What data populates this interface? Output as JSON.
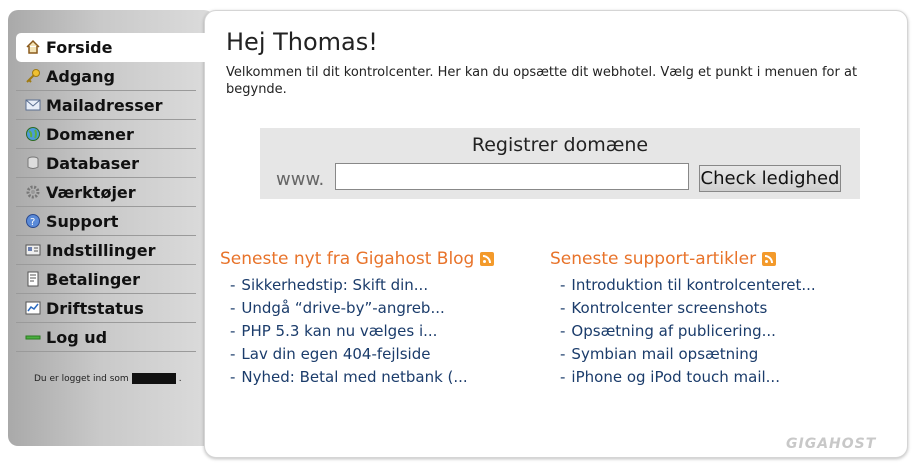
{
  "sidebar": {
    "items": [
      {
        "label": "Forside",
        "icon": "home-icon"
      },
      {
        "label": "Adgang",
        "icon": "key-icon"
      },
      {
        "label": "Mailadresser",
        "icon": "mail-icon"
      },
      {
        "label": "Domæner",
        "icon": "globe-icon"
      },
      {
        "label": "Databaser",
        "icon": "database-icon"
      },
      {
        "label": "Værktøjer",
        "icon": "gear-icon"
      },
      {
        "label": "Support",
        "icon": "help-icon"
      },
      {
        "label": "Indstillinger",
        "icon": "settings-card-icon"
      },
      {
        "label": "Betalinger",
        "icon": "invoice-icon"
      },
      {
        "label": "Driftstatus",
        "icon": "status-chart-icon"
      },
      {
        "label": "Log ud",
        "icon": "logout-icon"
      }
    ],
    "logged_in_prefix": "Du er logget ind som",
    "logged_in_suffix": "."
  },
  "main": {
    "title": "Hej Thomas!",
    "intro": "Velkommen til dit kontrolcenter. Her kan du opsætte dit webhotel. Vælg et punkt i menuen for at begynde.",
    "register": {
      "title": "Registrer domæne",
      "prefix": "www.",
      "input_value": "",
      "button": "Check ledighed"
    },
    "blog": {
      "heading": "Seneste nyt fra Gigahost Blog",
      "items": [
        "Sikkerhedstip: Skift din...",
        "Undgå “drive-by”-angreb...",
        "PHP 5.3 kan nu vælges i...",
        "Lav din egen 404-fejlside",
        "Nyhed: Betal med netbank (..."
      ]
    },
    "support": {
      "heading": "Seneste support-artikler",
      "items": [
        "Introduktion til kontrolcenteret...",
        "Kontrolcenter screenshots",
        "Opsætning af publicering...",
        "Symbian mail opsætning",
        "iPhone og iPod touch mail..."
      ]
    },
    "logo": "GIGAHOST"
  },
  "colors": {
    "accent": "#e8732a",
    "link": "#1b3c6b"
  }
}
